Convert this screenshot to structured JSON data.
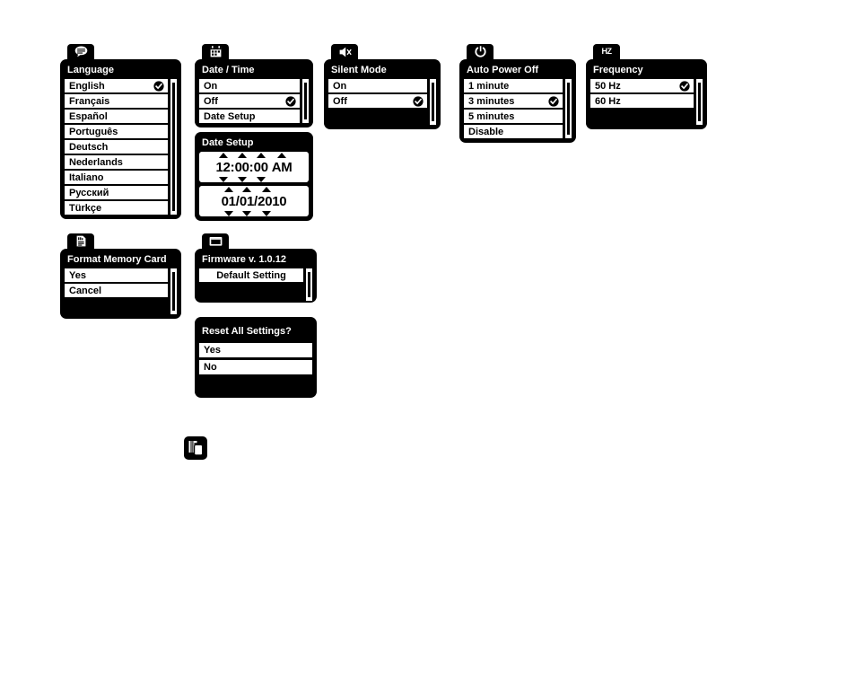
{
  "panels": {
    "language": {
      "tab_icon": "speech-bubble-icon",
      "title": "Language",
      "items": [
        {
          "label": "English",
          "selected": true
        },
        {
          "label": "Français",
          "selected": false
        },
        {
          "label": "Español",
          "selected": false
        },
        {
          "label": "Português",
          "selected": false
        },
        {
          "label": "Deutsch",
          "selected": false
        },
        {
          "label": "Nederlands",
          "selected": false
        },
        {
          "label": "Italiano",
          "selected": false
        },
        {
          "label": "Русский",
          "selected": false
        },
        {
          "label": "Türkçe",
          "selected": false
        }
      ]
    },
    "date_time": {
      "tab_icon": "calendar-icon",
      "title": "Date / Time",
      "items": [
        {
          "label": "On",
          "selected": false
        },
        {
          "label": "Off",
          "selected": true
        },
        {
          "label": "Date Setup",
          "selected": false
        }
      ]
    },
    "date_setup": {
      "title": "Date Setup",
      "time": {
        "segments": [
          "12",
          "00",
          "00",
          "AM"
        ],
        "separators": [
          ":",
          ":",
          " "
        ],
        "value": "12:00:00 AM"
      },
      "date": {
        "segments": [
          "01",
          "01",
          "2010"
        ],
        "separators": [
          "/",
          "/"
        ],
        "value": "01/01/2010"
      }
    },
    "silent_mode": {
      "tab_icon": "mute-speaker-icon",
      "title": "Silent Mode",
      "items": [
        {
          "label": "On",
          "selected": false
        },
        {
          "label": "Off",
          "selected": true
        }
      ]
    },
    "auto_power_off": {
      "tab_icon": "power-icon",
      "title": "Auto Power Off",
      "items": [
        {
          "label": "1 minute",
          "selected": false
        },
        {
          "label": "3 minutes",
          "selected": true
        },
        {
          "label": "5 minutes",
          "selected": false
        },
        {
          "label": "Disable",
          "selected": false
        }
      ]
    },
    "frequency": {
      "tab_icon": "hz-icon",
      "tab_text": "HZ",
      "title": "Frequency",
      "items": [
        {
          "label": "50 Hz",
          "selected": true
        },
        {
          "label": "60 Hz",
          "selected": false
        }
      ]
    },
    "format_memory_card": {
      "tab_icon": "memory-card-icon",
      "title": "Format Memory Card",
      "items": [
        {
          "label": "Yes",
          "selected": false
        },
        {
          "label": "Cancel",
          "selected": false
        }
      ]
    },
    "firmware": {
      "tab_icon": "monitor-icon",
      "title": "Firmware v. 1.0.12",
      "items": [
        {
          "label": "Default Setting",
          "selected": false
        }
      ]
    },
    "reset_all": {
      "title": "Reset All Settings?",
      "items": [
        {
          "label": "Yes",
          "selected": false
        },
        {
          "label": "No",
          "selected": false
        }
      ]
    }
  },
  "standalone_icon": {
    "name": "stacked-pages-icon"
  },
  "colors": {
    "panel_background": "#000000",
    "row_background": "#ffffff",
    "text_on_panel": "#ffffff",
    "text_on_row": "#000000",
    "page_background": "#ffffff"
  }
}
